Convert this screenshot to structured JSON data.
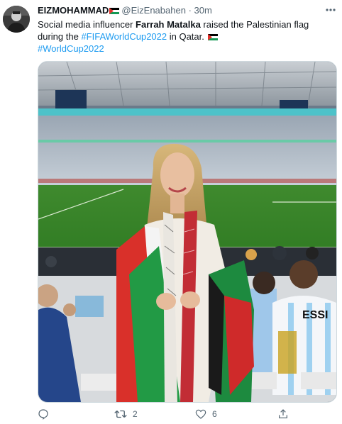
{
  "author": {
    "display_name": "EIZMOHAMMAD",
    "handle": "@EizEnabahen",
    "separator": "·",
    "time": "30m"
  },
  "tweet": {
    "text_part1": "Social media influencer ",
    "text_bold": "Farrah Matalka",
    "text_part2": " raised the Palestinian flag during the ",
    "hashtag1": "#FIFAWorldCup2022",
    "text_part3": " in Qatar. ",
    "hashtag2": "#WorldCup2022"
  },
  "media": {
    "jersey_text": "ESSI"
  },
  "actions": {
    "retweet_count": "2",
    "like_count": "6"
  },
  "icons": {
    "more": "more-dots-icon",
    "reply": "reply-icon",
    "retweet": "retweet-icon",
    "like": "heart-icon",
    "share": "share-icon",
    "flag": "palestinian-flag-icon"
  }
}
